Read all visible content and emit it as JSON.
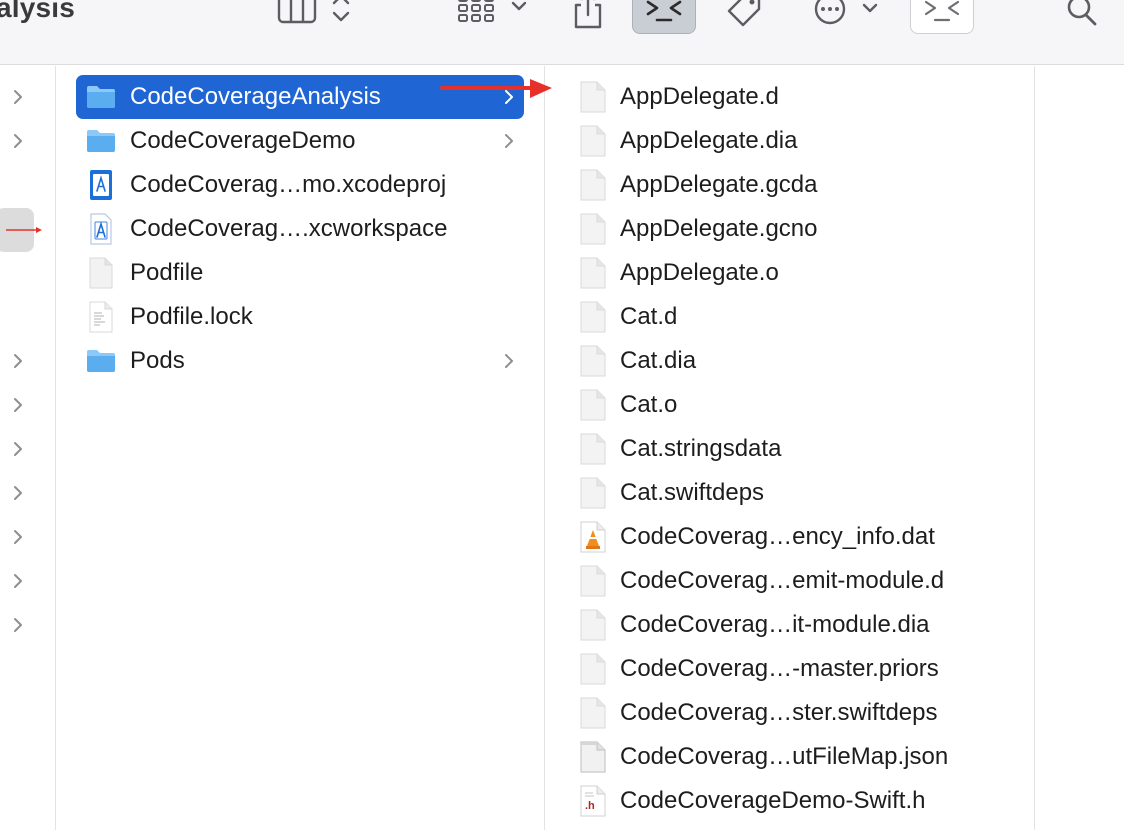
{
  "window": {
    "title": "alysis"
  },
  "toolbar": {
    "buttons": [
      {
        "name": "view-columns",
        "icon": "column-view-icon"
      },
      {
        "name": "group-by",
        "icon": "grid-group-icon"
      },
      {
        "name": "share",
        "icon": "share-icon"
      },
      {
        "name": "terminal-active",
        "icon": "terminal-icon"
      },
      {
        "name": "tags",
        "icon": "tag-icon"
      },
      {
        "name": "more-actions",
        "icon": "ellipsis-circle-icon"
      },
      {
        "name": "terminal-2",
        "icon": "terminal-icon"
      },
      {
        "name": "search",
        "icon": "search-icon"
      }
    ]
  },
  "middle_column": {
    "items": [
      {
        "label": "CodeCoverageAnalysis",
        "kind": "folder",
        "selected": true,
        "has_children": true
      },
      {
        "label": "CodeCoverageDemo",
        "kind": "folder",
        "selected": false,
        "has_children": true
      },
      {
        "label": "CodeCoverag…mo.xcodeproj",
        "kind": "xcodeproj",
        "selected": false,
        "has_children": false
      },
      {
        "label": "CodeCoverag….xcworkspace",
        "kind": "xcworkspace",
        "selected": false,
        "has_children": false
      },
      {
        "label": "Podfile",
        "kind": "document",
        "selected": false,
        "has_children": false
      },
      {
        "label": "Podfile.lock",
        "kind": "text-document",
        "selected": false,
        "has_children": false
      },
      {
        "label": "Pods",
        "kind": "folder",
        "selected": false,
        "has_children": true
      }
    ]
  },
  "right_column": {
    "items": [
      {
        "label": "AppDelegate.d",
        "kind": "document"
      },
      {
        "label": "AppDelegate.dia",
        "kind": "document"
      },
      {
        "label": "AppDelegate.gcda",
        "kind": "document"
      },
      {
        "label": "AppDelegate.gcno",
        "kind": "document"
      },
      {
        "label": "AppDelegate.o",
        "kind": "document"
      },
      {
        "label": "Cat.d",
        "kind": "document"
      },
      {
        "label": "Cat.dia",
        "kind": "document"
      },
      {
        "label": "Cat.o",
        "kind": "document"
      },
      {
        "label": "Cat.stringsdata",
        "kind": "document"
      },
      {
        "label": "Cat.swiftdeps",
        "kind": "document"
      },
      {
        "label": "CodeCoverag…ency_info.dat",
        "kind": "vlc-document"
      },
      {
        "label": "CodeCoverag…emit-module.d",
        "kind": "document"
      },
      {
        "label": "CodeCoverag…it-module.dia",
        "kind": "document"
      },
      {
        "label": "CodeCoverag…-master.priors",
        "kind": "document"
      },
      {
        "label": "CodeCoverag…ster.swiftdeps",
        "kind": "document"
      },
      {
        "label": "CodeCoverag…utFileMap.json",
        "kind": "json-document"
      },
      {
        "label": "CodeCoverageDemo-Swift.h",
        "kind": "header-document",
        "badge": ".h"
      }
    ]
  },
  "colors": {
    "selection": "#1f66d4",
    "folder": "#5aaef0",
    "annotation_arrow": "#e8302a",
    "toolbar_bg": "#f6f5f7"
  }
}
